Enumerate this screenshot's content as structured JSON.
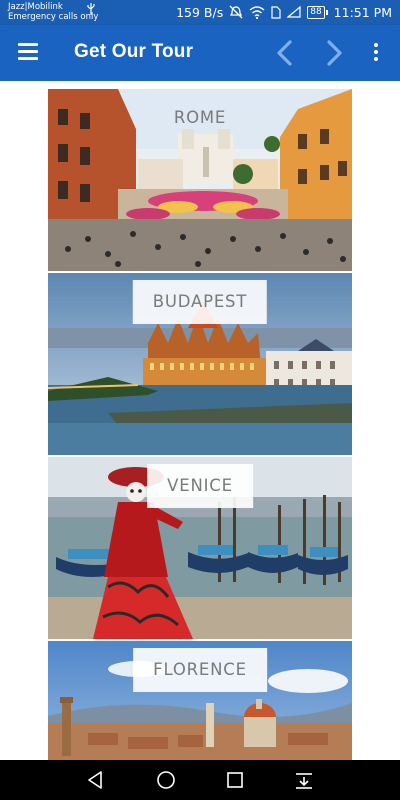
{
  "status_bar": {
    "carrier": "Jazz|Mobilink",
    "emergency": "Emergency calls only",
    "speed": "159 B/s",
    "battery": "88",
    "time": "11:51 PM",
    "background": "#1a5fb4"
  },
  "app_bar": {
    "title": "Get Our Tour",
    "background": "#1b63c1",
    "arrow_color": "#7fb0ec"
  },
  "tours": [
    {
      "name": "ROME",
      "icon": "rome-photo"
    },
    {
      "name": "BUDAPEST",
      "icon": "budapest-photo"
    },
    {
      "name": "VENICE",
      "icon": "venice-photo"
    },
    {
      "name": "FLORENCE",
      "icon": "florence-photo"
    }
  ],
  "nav_bar": {
    "buttons": [
      "back-icon",
      "home-icon",
      "recents-icon",
      "notification-pull-icon"
    ]
  }
}
